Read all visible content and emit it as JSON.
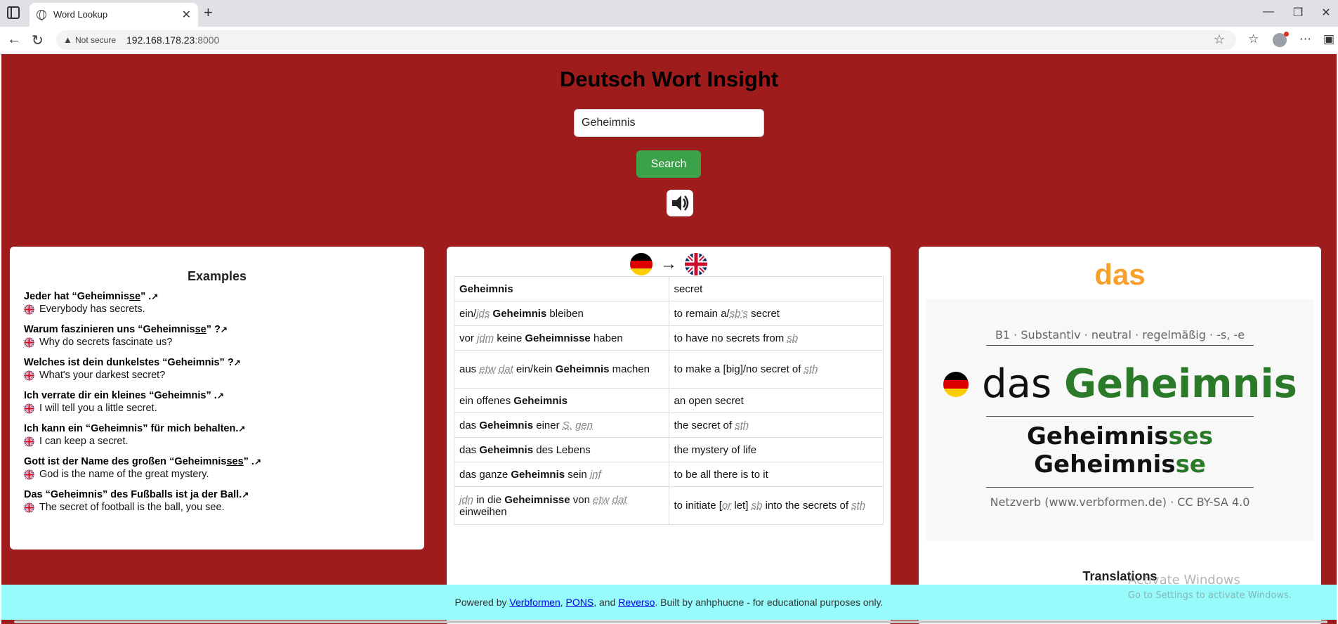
{
  "browser": {
    "tab_title": "Word Lookup",
    "not_secure": "Not secure",
    "url_host": "192.168.178.23",
    "url_port": ":8000"
  },
  "site": {
    "title": "Deutsch Wort Insight",
    "search_value": "Geheimnis",
    "search_button": "Search"
  },
  "examples": {
    "heading": "Examples",
    "items": [
      {
        "de_pre": "Jeder hat “Geheimnis",
        "de_u": "se",
        "de_post": "” .",
        "en": "Everybody has secrets."
      },
      {
        "de_pre": "Warum faszinieren uns “Geheimnis",
        "de_u": "se",
        "de_post": "” ?",
        "en": "Why do secrets fascinate us?"
      },
      {
        "de_pre": "Welches ist dein dunkelstes “Geheimnis” ?",
        "de_u": "",
        "de_post": "",
        "en": "What's your darkest secret?"
      },
      {
        "de_pre": "Ich verrate dir ein kleines “Geheimnis” .",
        "de_u": "",
        "de_post": "",
        "en": "I will tell you a little secret."
      },
      {
        "de_pre": "Ich kann ein “Geheimnis” für mich behalten.",
        "de_u": "",
        "de_post": "",
        "en": "I can keep a secret."
      },
      {
        "de_pre": "Gott ist der Name des großen “Geheimnis",
        "de_u": "ses",
        "de_post": "” .",
        "en": "God is the name of the great mystery."
      },
      {
        "de_pre": "Das “Geheimnis” des Fußballs ist ja der Ball.",
        "de_u": "",
        "de_post": "",
        "en": "The secret of football is the ball, you see."
      }
    ]
  },
  "translation": {
    "arrow": "→",
    "rows": [
      {
        "de": [
          [
            "b",
            "Geheimnis"
          ]
        ],
        "en": [
          [
            "t",
            "secret"
          ]
        ]
      },
      {
        "de": [
          [
            "t",
            "ein/"
          ],
          [
            "a",
            "jds"
          ],
          [
            "t",
            " "
          ],
          [
            "b",
            "Geheimnis"
          ],
          [
            "t",
            " bleiben"
          ]
        ],
        "en": [
          [
            "t",
            "to remain a/"
          ],
          [
            "a",
            "sb's"
          ],
          [
            "t",
            " secret"
          ]
        ]
      },
      {
        "de": [
          [
            "t",
            "vor "
          ],
          [
            "a",
            "jdm"
          ],
          [
            "t",
            " keine "
          ],
          [
            "b",
            "Geheimnisse"
          ],
          [
            "t",
            " haben"
          ]
        ],
        "en": [
          [
            "t",
            "to have no secrets from "
          ],
          [
            "a",
            "sb"
          ]
        ]
      },
      {
        "de": [
          [
            "t",
            "aus "
          ],
          [
            "a",
            "etw"
          ],
          [
            "t",
            " "
          ],
          [
            "a",
            "dat"
          ],
          [
            "t",
            " ein/kein "
          ],
          [
            "b",
            "Geheimnis"
          ],
          [
            "t",
            " machen"
          ]
        ],
        "en": [
          [
            "t",
            "to make a [big]/no secret of "
          ],
          [
            "a",
            "sth"
          ]
        ]
      },
      {
        "de": [
          [
            "t",
            "ein offenes "
          ],
          [
            "b",
            "Geheimnis"
          ]
        ],
        "en": [
          [
            "t",
            "an open secret"
          ]
        ]
      },
      {
        "de": [
          [
            "t",
            "das "
          ],
          [
            "b",
            "Geheimnis"
          ],
          [
            "t",
            " einer "
          ],
          [
            "a",
            "S."
          ],
          [
            "t",
            " "
          ],
          [
            "a",
            "gen"
          ]
        ],
        "en": [
          [
            "t",
            "the secret of "
          ],
          [
            "a",
            "sth"
          ]
        ]
      },
      {
        "de": [
          [
            "t",
            "das "
          ],
          [
            "b",
            "Geheimnis"
          ],
          [
            "t",
            " des Lebens"
          ]
        ],
        "en": [
          [
            "t",
            "the mystery of life"
          ]
        ]
      },
      {
        "de": [
          [
            "t",
            "das ganze "
          ],
          [
            "b",
            "Geheimnis"
          ],
          [
            "t",
            " sein "
          ],
          [
            "a",
            "inf"
          ]
        ],
        "en": [
          [
            "t",
            "to be all there is to it"
          ]
        ]
      },
      {
        "de": [
          [
            "a",
            "jdn"
          ],
          [
            "t",
            " in die "
          ],
          [
            "b",
            "Geheimnisse"
          ],
          [
            "t",
            " von "
          ],
          [
            "a",
            "etw"
          ],
          [
            "t",
            " "
          ],
          [
            "a",
            "dat"
          ],
          [
            "t",
            " einweihen"
          ]
        ],
        "en": [
          [
            "t",
            "to initiate ["
          ],
          [
            "a",
            "or"
          ],
          [
            "t",
            " let] "
          ],
          [
            "a",
            "sb"
          ],
          [
            "t",
            " into the secrets of "
          ],
          [
            "a",
            "sth"
          ]
        ]
      }
    ]
  },
  "grammar": {
    "article": "das",
    "meta": "B1 · Substantiv · neutral · regelmäßig · -s, -e",
    "word_article": "das",
    "word": "Geheimnis",
    "form1_stem": "Geheimnis",
    "form1_end": "ses",
    "form2_stem": "Geheimnis",
    "form2_end": "se",
    "source": "Netzverb (www.verbformen.de) · CC BY-SA 4.0",
    "translations_heading": "Translations"
  },
  "footer": {
    "t1": "Powered by ",
    "link1": "Verbformen",
    "t2": ", ",
    "link2": "PONS",
    "t3": ", and ",
    "link3": "Reverso",
    "t4": ". Built by anhphucne - for educational purposes only."
  },
  "watermark": {
    "line1": "Activate Windows",
    "line2": "Go to Settings to activate Windows."
  },
  "colors": {
    "page_bg": "#9e1c1c",
    "search_button": "#3ba24a",
    "article_orange": "#f6a02e",
    "noun_green": "#2a7a2a",
    "footer_bg": "#98fbfb"
  }
}
